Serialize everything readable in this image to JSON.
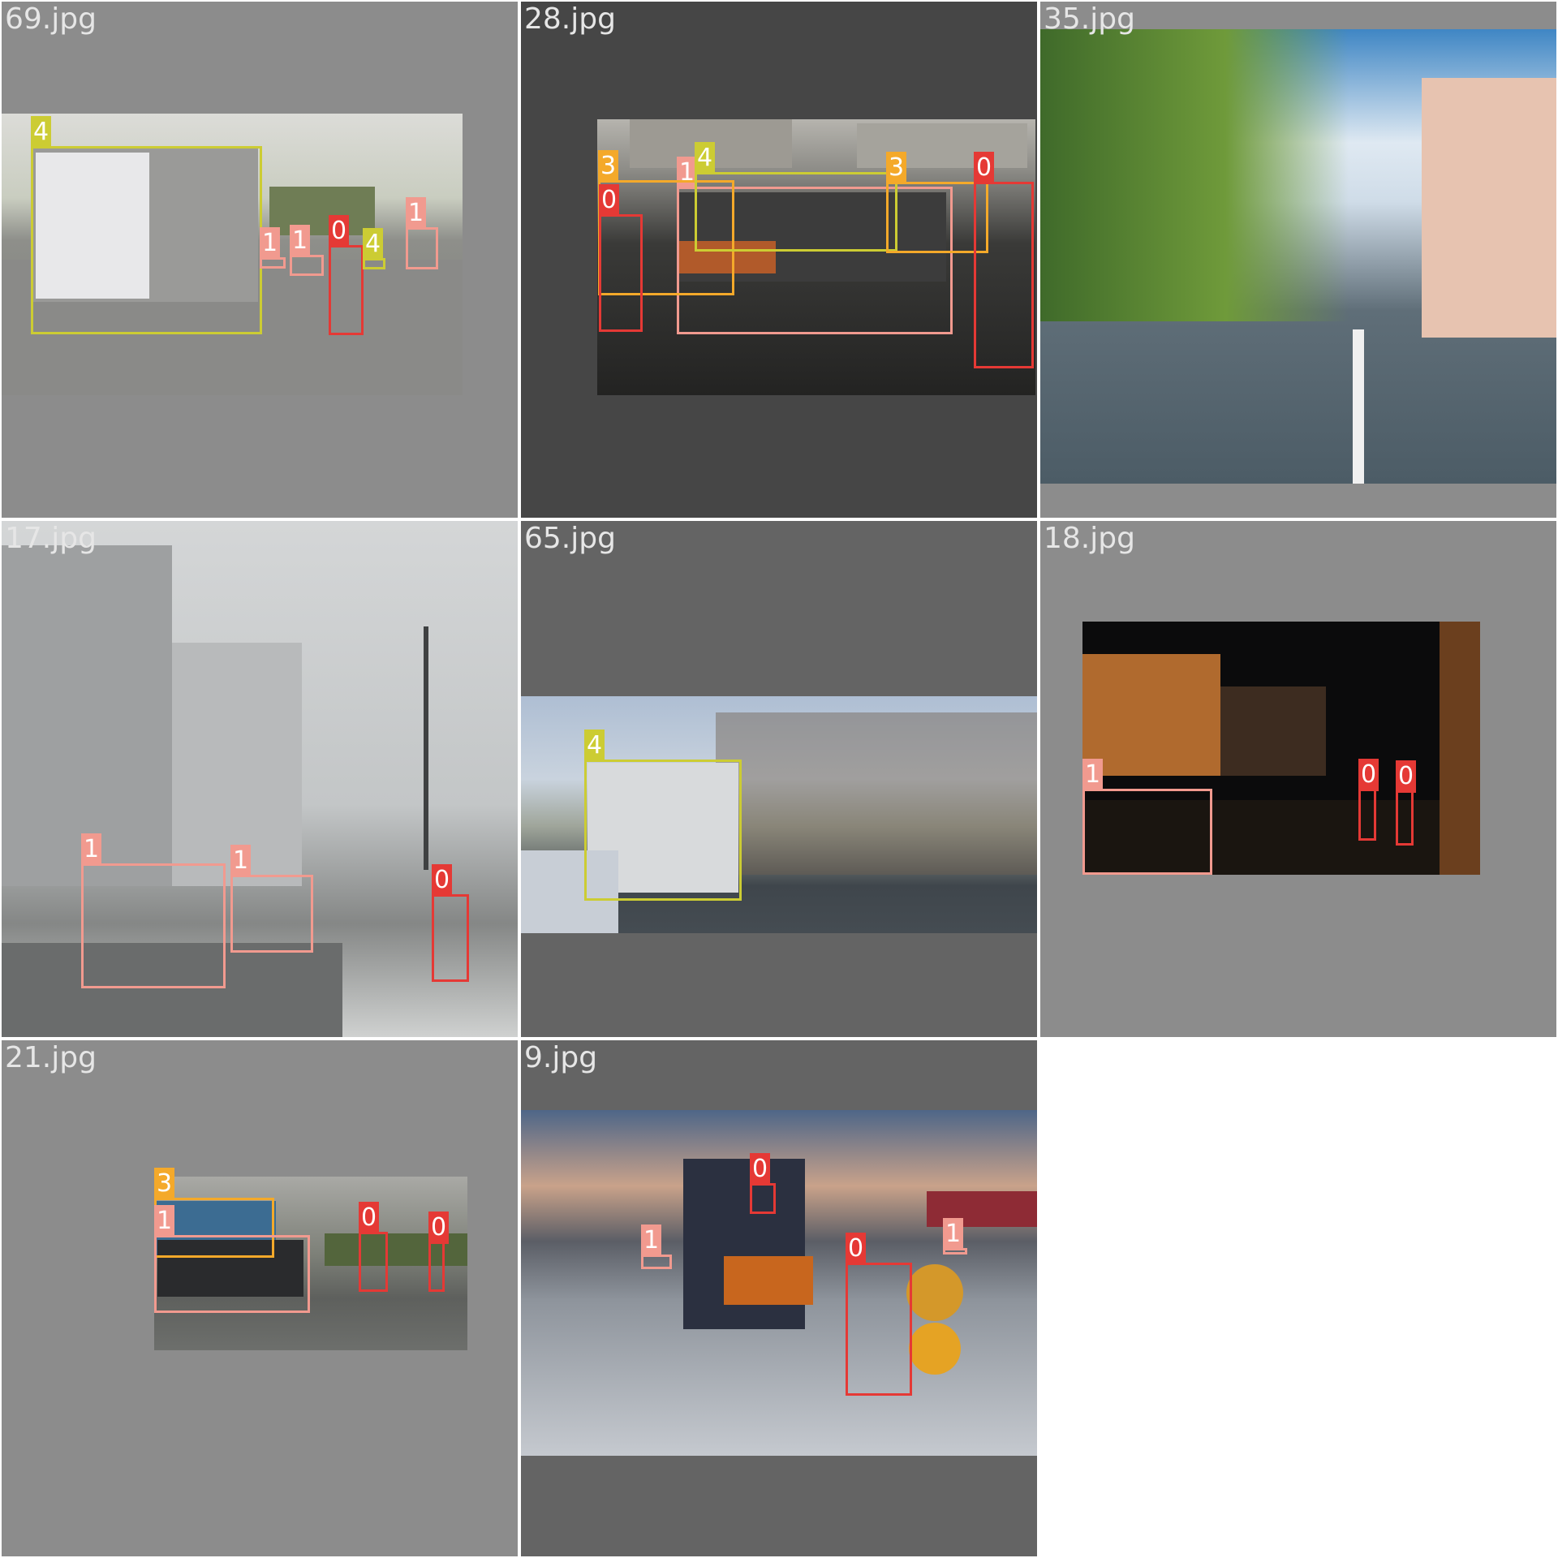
{
  "grid": {
    "cells": [
      {
        "filename": "69.jpg",
        "background": "#8c8c8c"
      },
      {
        "filename": "28.jpg",
        "background": "#464646"
      },
      {
        "filename": "35.jpg",
        "background": "#8c8c8c"
      },
      {
        "filename": "17.jpg",
        "background": "#8c8c8c"
      },
      {
        "filename": "65.jpg",
        "background": "#646464"
      },
      {
        "filename": "18.jpg",
        "background": "#8c8c8c"
      },
      {
        "filename": "21.jpg",
        "background": "#8c8c8c"
      },
      {
        "filename": "9.jpg",
        "background": "#646464"
      }
    ]
  },
  "class_colors": {
    "0": "#e53935",
    "1": "#f19a8f",
    "3": "#f4a92a",
    "4": "#cccc33"
  },
  "labels": {
    "cls0": "0",
    "cls1": "1",
    "cls3": "3",
    "cls4": "4"
  }
}
